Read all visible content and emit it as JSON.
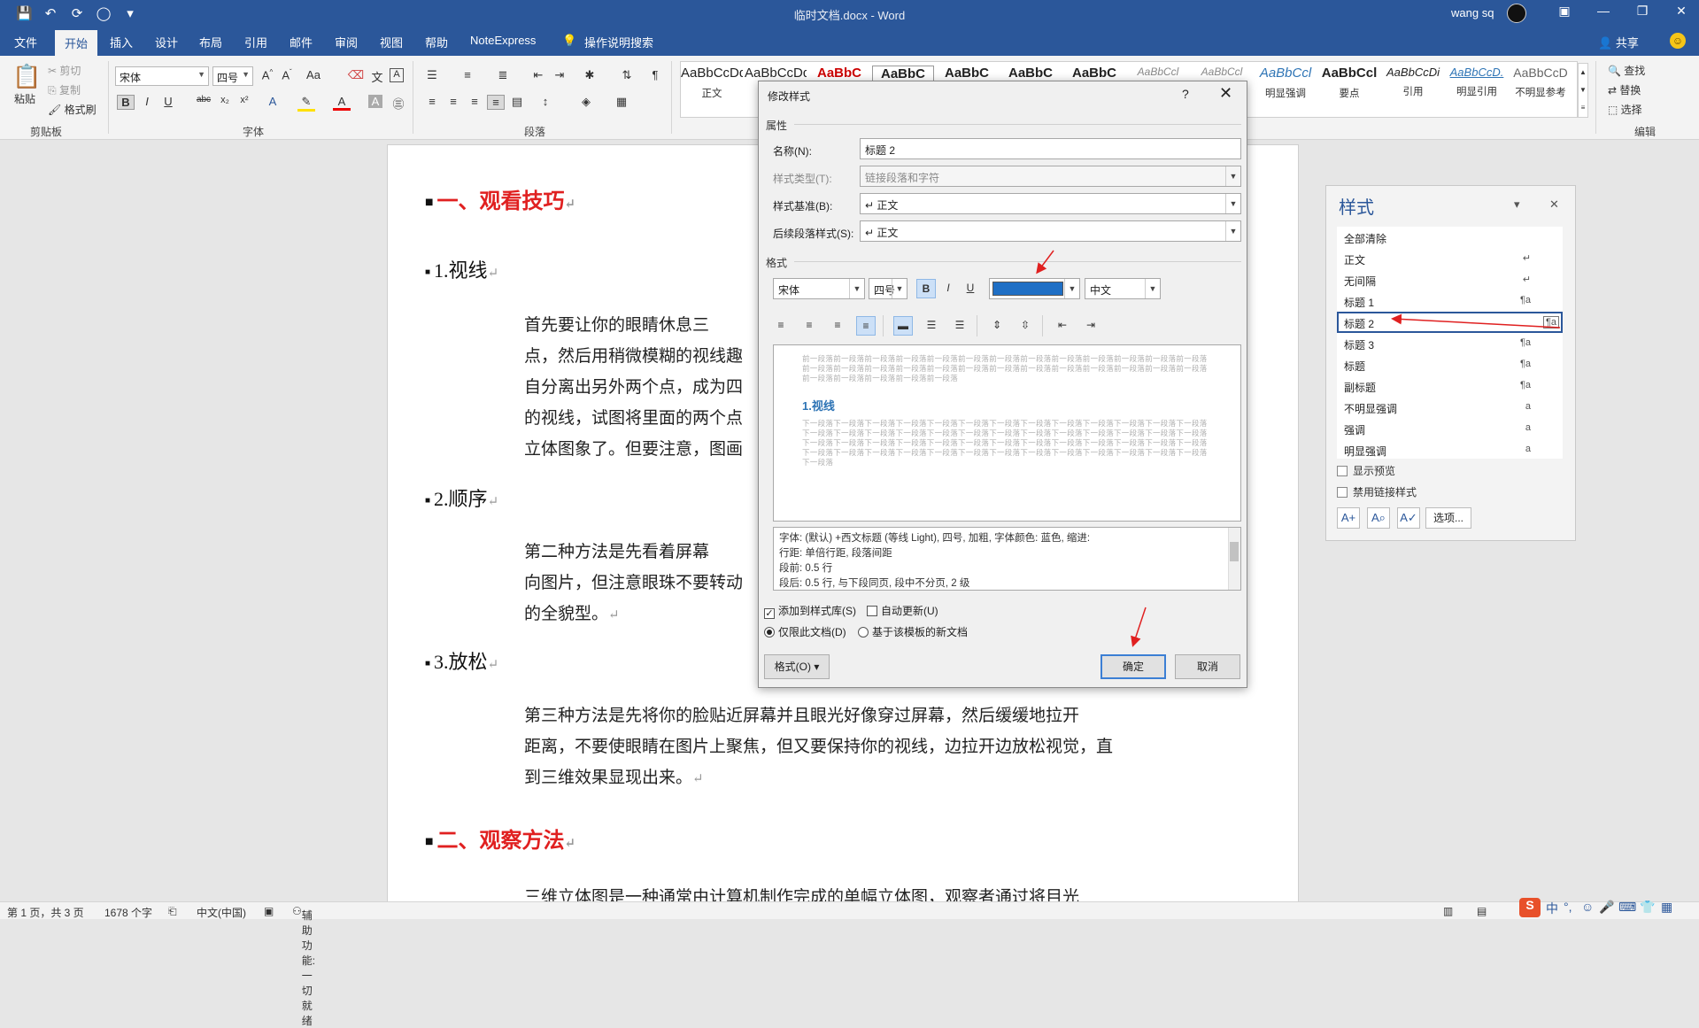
{
  "titlebar": {
    "quick_access": [
      "💾",
      "↶",
      "⟳",
      "◯",
      "▾"
    ],
    "doc_title": "临时文档.docx  -  Word",
    "user": "wang sq",
    "window_buttons": [
      "▣",
      "—",
      "❐",
      "✕"
    ]
  },
  "tabs": [
    "文件",
    "开始",
    "插入",
    "设计",
    "布局",
    "引用",
    "邮件",
    "审阅",
    "视图",
    "帮助",
    "NoteExpress",
    "操作说明搜索"
  ],
  "share": "共享",
  "ribbon": {
    "clipboard": {
      "paste": "粘贴",
      "cut": "剪切",
      "copy": "复制",
      "format_painter": "格式刷",
      "label": "剪贴板"
    },
    "font": {
      "name": "宋体",
      "size": "四号",
      "label": "字体"
    },
    "paragraph": {
      "label": "段落"
    },
    "styles_gallery": [
      {
        "preview": "AaBbCcDd",
        "name": "正文"
      },
      {
        "preview": "AaBbCcDd",
        "name": ""
      },
      {
        "preview": "AaBbC",
        "name": ""
      },
      {
        "preview": "AaBbC",
        "name": ""
      },
      {
        "preview": "AaBbC",
        "name": ""
      },
      {
        "preview": "AaBbC",
        "name": ""
      },
      {
        "preview": "AaBbC",
        "name": ""
      },
      {
        "preview": "AaBbCcl",
        "name": ""
      },
      {
        "preview": "AaBbCcl",
        "name": ""
      },
      {
        "preview": "AaBbCcl",
        "name": "明显强调"
      },
      {
        "preview": "AaBbCcl",
        "name": "要点"
      },
      {
        "preview": "AaBbCcDi",
        "name": "引用"
      },
      {
        "preview": "AaBbCcD.",
        "name": "明显引用"
      },
      {
        "preview": "AaBbCcD",
        "name": "不明显参考"
      }
    ],
    "editing": {
      "find": "查找",
      "replace": "替换",
      "select": "选择",
      "label": "编辑"
    }
  },
  "document": {
    "h1_a": "一、观看技巧",
    "h2_1": "1.视线",
    "p1": [
      "首先要让你的眼睛休息三",
      "点，然后用稍微模糊的视线趣",
      "自分离出另外两个点，成为四",
      "的视线，试图将里面的两个点",
      "立体图象了。但要注意，图画"
    ],
    "h2_2": "2.顺序",
    "p2": [
      "第二种方法是先看着屏幕",
      "向图片，但注意眼珠不要转动",
      "的全貌型。"
    ],
    "h2_3": "3.放松",
    "p3": [
      "第三种方法是先将你的脸贴近屏幕并且眼光好像穿过屏幕，然后缓缓地拉开",
      "距离，不要使眼睛在图片上聚焦，但又要保持你的视线，边拉开边放松视觉，直",
      "到三维效果显现出来。"
    ],
    "h1_b": "二、观察方法",
    "p4": "三维立体图是一种通常由计算机制作完成的单幅立体图，观察者通过将目光"
  },
  "styles_pane": {
    "title": "样式",
    "items": [
      {
        "name": "全部清除",
        "kind": ""
      },
      {
        "name": "正文",
        "kind": "↵"
      },
      {
        "name": "无间隔",
        "kind": "↵"
      },
      {
        "name": "标题 1",
        "kind": "¶a"
      },
      {
        "name": "标题 2",
        "kind": "¶a"
      },
      {
        "name": "标题 3",
        "kind": "¶a"
      },
      {
        "name": "标题",
        "kind": "¶a"
      },
      {
        "name": "副标题",
        "kind": "¶a"
      },
      {
        "name": "不明显强调",
        "kind": "a"
      },
      {
        "name": "强调",
        "kind": "a"
      },
      {
        "name": "明显强调",
        "kind": "a"
      }
    ],
    "show_preview": "显示预览",
    "disable_linked": "禁用链接样式",
    "options": "选项..."
  },
  "dialog": {
    "title": "修改样式",
    "help": "?",
    "close": "✕",
    "section_props": "属性",
    "name_label": "名称(N):",
    "name_value": "标题 2",
    "type_label": "样式类型(T):",
    "type_value": "链接段落和字符",
    "based_label": "样式基准(B):",
    "based_value": "↵ 正文",
    "next_label": "后续段落样式(S):",
    "next_value": "↵ 正文",
    "section_format": "格式",
    "font": "宋体",
    "size": "四号",
    "bold": "B",
    "italic": "I",
    "underline": "U",
    "font_color": "#1f6fc5",
    "script": "中文",
    "preview_prev": "前一段落前一段落前一段落前一段落前一段落前一段落前一段落前一段落前一段落前一段落前一段落前一段落前一段落",
    "preview_prev_tail": "前一段落前一段落前一段落前一段落前一段落",
    "preview_heading": "1.视线",
    "preview_next": "下一段落下一段落下一段落下一段落下一段落下一段落下一段落下一段落下一段落下一段落下一段落下一段落下一段落",
    "preview_next_tail": "下一段落",
    "desc_lines": [
      "字体: (默认) +西文标题 (等线 Light), 四号, 加粗, 字体颜色: 蓝色, 缩进:",
      "    行距: 单倍行距, 段落间距",
      "    段前: 0.5 行",
      "    段后: 0.5 行, 与下段同页, 段中不分页, 2 级"
    ],
    "add_gallery": "添加到样式库(S)",
    "auto_update": "自动更新(U)",
    "only_doc": "仅限此文档(D)",
    "new_template": "基于该模板的新文档",
    "format_btn": "格式(O) ▾",
    "ok": "确定",
    "cancel": "取消"
  },
  "statusbar": {
    "page": "第 1 页，共 3 页",
    "words": "1678 个字",
    "lang": "中文(中国)",
    "accessibility": "辅助功能: 一切就绪"
  },
  "tray": [
    "S",
    "中",
    "°,",
    "☺",
    "🎤",
    "⌨",
    "👕",
    "▦"
  ]
}
